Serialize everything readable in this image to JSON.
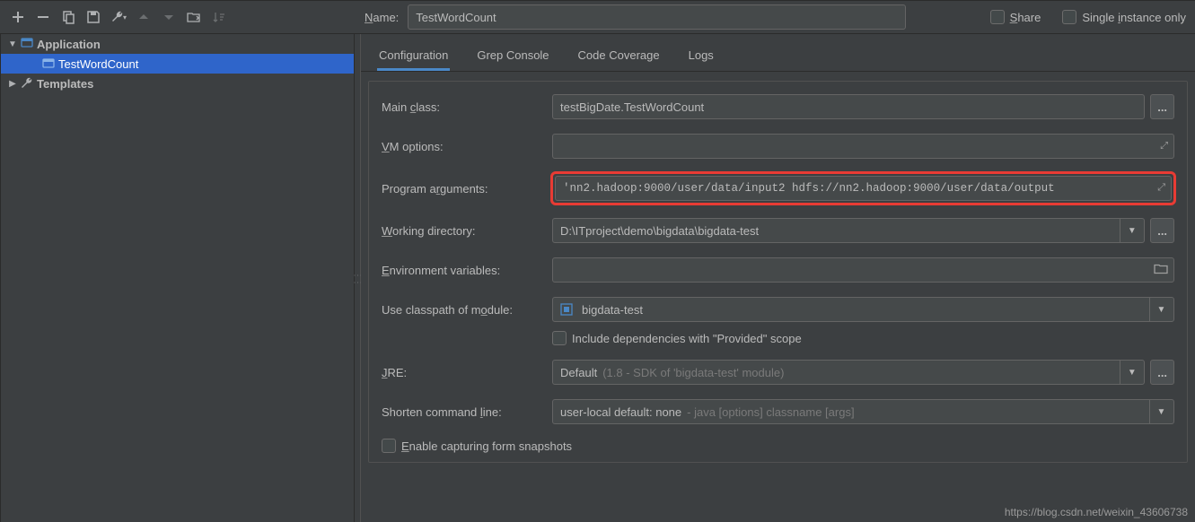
{
  "toolbar": {},
  "sidebar": {
    "application_label": "Application",
    "item_label": "TestWordCount",
    "templates_label": "Templates"
  },
  "name": {
    "label": "Name:",
    "value": "TestWordCount"
  },
  "share_label": "Share",
  "single_instance_label": "Single instance only",
  "tabs": {
    "configuration": "Configuration",
    "grep": "Grep Console",
    "coverage": "Code Coverage",
    "logs": "Logs"
  },
  "form": {
    "main_class_label": "Main class:",
    "main_class_value": "testBigDate.TestWordCount",
    "vm_label": "VM options:",
    "vm_value": "",
    "args_label": "Program arguments:",
    "args_value": "'nn2.hadoop:9000/user/data/input2 hdfs://nn2.hadoop:9000/user/data/output",
    "wd_label": "Working directory:",
    "wd_value": "D:\\ITproject\\demo\\bigdata\\bigdata-test",
    "env_label": "Environment variables:",
    "env_value": "",
    "classpath_label": "Use classpath of module:",
    "classpath_value": "bigdata-test",
    "include_provided_label": "Include dependencies with \"Provided\" scope",
    "jre_label": "JRE:",
    "jre_value": "Default ",
    "jre_hint": "(1.8 - SDK of 'bigdata-test' module)",
    "shorten_label": "Shorten command line:",
    "shorten_value": "user-local default: none ",
    "shorten_hint": "- java [options] classname [args]",
    "enable_snapshots_label": "Enable capturing form snapshots"
  },
  "watermark": "https://blog.csdn.net/weixin_43606738"
}
